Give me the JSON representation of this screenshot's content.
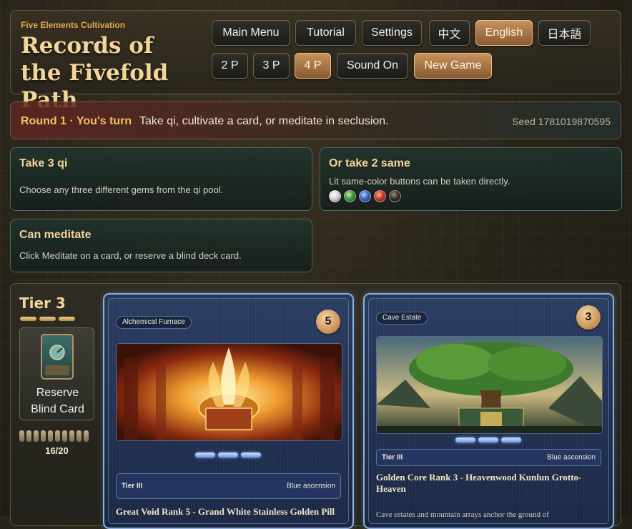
{
  "brand": {
    "subtitle": "Five Elements Cultivation",
    "title": "Records of the Fivefold Path"
  },
  "menu": {
    "main_menu": "Main Menu",
    "tutorial": "Tutorial",
    "settings": "Settings",
    "lang_zh": "中文",
    "lang_en": "English",
    "lang_ja": "日本語",
    "active_language": "English"
  },
  "players": {
    "p2": "2 P",
    "p3": "3 P",
    "p4": "4 P",
    "active": "4 P"
  },
  "sound_label": "Sound On",
  "new_game_label": "New Game",
  "status": {
    "round": "Round 1 · You's turn",
    "message": "Take qi, cultivate a card, or meditate in seclusion.",
    "seed": "Seed 1781019870595"
  },
  "actions": {
    "take3": {
      "title": "Take 3 qi",
      "desc": "Choose any three different gems from the qi pool."
    },
    "take2": {
      "title": "Or take 2 same",
      "desc": "Lit same-color buttons can be taken directly."
    },
    "meditate": {
      "title": "Can meditate",
      "desc": "Click Meditate on a card, or reserve a blind deck card."
    }
  },
  "gem_colors": [
    "#d8d8d8",
    "#3e9a3a",
    "#3a68c8",
    "#c83a2a",
    "#3a3030"
  ],
  "tier": {
    "title": "Tier 3",
    "reserve_label_1": "Reserve",
    "reserve_label_2": "Blind Card",
    "deck_count": "16/20",
    "deck_fill_fraction": 0.8
  },
  "cards": [
    {
      "category": "Alchemical Furnace",
      "points": "5",
      "tier_label": "Tier III",
      "ascension": "Blue ascension",
      "name": "Great Void Rank 5 - Grand White Stainless Golden Pill",
      "desc": ""
    },
    {
      "category": "Cave Estate",
      "points": "3",
      "tier_label": "Tier III",
      "ascension": "Blue ascension",
      "name": "Golden Core Rank 3 - Heavenwood Kunlun Grotto-Heaven",
      "desc": "Cave estates and mountain arrays anchor the ground of"
    }
  ]
}
